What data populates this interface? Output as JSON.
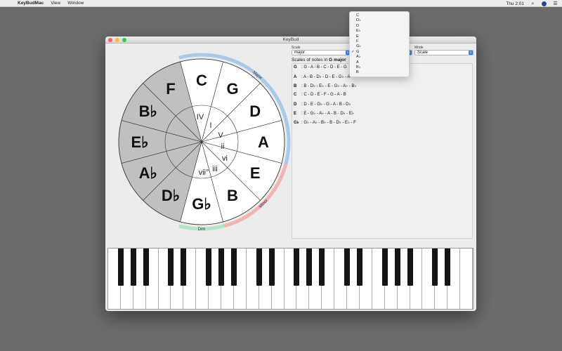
{
  "menubar": {
    "app_name": "KeyBudMac",
    "items": [
      "View",
      "Window"
    ],
    "clock": "Thu 2:01"
  },
  "window": {
    "title": "KeyBud"
  },
  "controls": {
    "scale_label": "Scale",
    "scale_value": "major",
    "mode_label": "Mode",
    "mode_value": "Scale"
  },
  "scales": {
    "title_prefix": "Scales of notes in ",
    "title_key": "G major",
    "rows": [
      {
        "key": "G",
        "notes": ": G - A - B - C - D - E - G"
      },
      {
        "key": "A",
        "notes": ": A - B - D♭ - D - E - G♭ - A"
      },
      {
        "key": "B",
        "notes": ": B - D♭ - E♭ - E - G♭ - A♭ - B♭"
      },
      {
        "key": "C",
        "notes": ": C - D - E - F - G - A - B"
      },
      {
        "key": "D",
        "notes": ": D - E - G♭ - G - A - B - D♭"
      },
      {
        "key": "E",
        "notes": ": E - G♭ - A♭ - A - B - D♭ - E♭"
      },
      {
        "key": "G♭",
        "notes": ": G♭ - A♭ - B♭ - B - D♭ - E♭ - F"
      }
    ]
  },
  "dropdown": {
    "items": [
      "C",
      "D♭",
      "D",
      "E♭",
      "E",
      "F",
      "G♭",
      "G",
      "A♭",
      "A",
      "B♭",
      "B"
    ],
    "selected": "G"
  },
  "wheel": {
    "keys": [
      {
        "note": "C",
        "shaded": false
      },
      {
        "note": "G",
        "shaded": false
      },
      {
        "note": "D",
        "shaded": false
      },
      {
        "note": "A",
        "shaded": false
      },
      {
        "note": "E",
        "shaded": false
      },
      {
        "note": "B",
        "shaded": false
      },
      {
        "note": "G♭",
        "shaded": false
      },
      {
        "note": "D♭",
        "shaded": true
      },
      {
        "note": "A♭",
        "shaded": true
      },
      {
        "note": "E♭",
        "shaded": true
      },
      {
        "note": "B♭",
        "shaded": true
      },
      {
        "note": "F",
        "shaded": true
      }
    ],
    "numerals": [
      "IV",
      "I",
      "V",
      "ii",
      "vi",
      "iii",
      "vii°"
    ],
    "arc_labels": {
      "major": "Major",
      "minor": "Minor",
      "dim": "Dim"
    },
    "colors": {
      "major": "#a9c9ea",
      "minor": "#f1b4b4",
      "dim": "#b6e6c6",
      "shade": "#c0c0c0"
    }
  }
}
